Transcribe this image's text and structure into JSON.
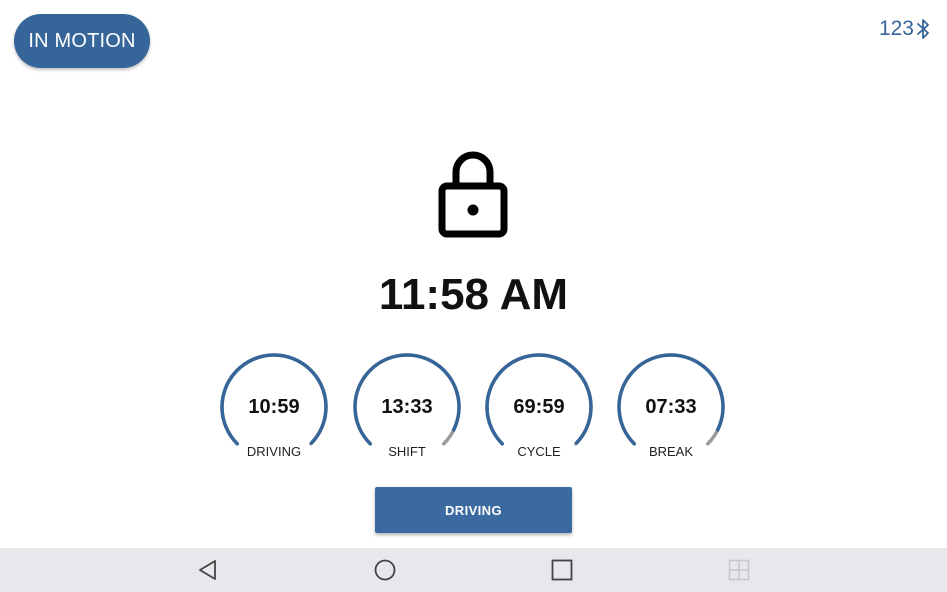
{
  "header": {
    "status_label": "IN MOTION",
    "device_id": "123",
    "bluetooth_icon": "bluetooth-icon"
  },
  "lock_icon": "lock-icon",
  "clock": {
    "time": "11:58 AM"
  },
  "gauges": [
    {
      "label": "DRIVING",
      "value": "10:59",
      "fill": 0.995
    },
    {
      "label": "SHIFT",
      "value": "13:33",
      "fill": 0.93
    },
    {
      "label": "CYCLE",
      "value": "69:59",
      "fill": 0.995
    },
    {
      "label": "BREAK",
      "value": "07:33",
      "fill": 0.93
    }
  ],
  "action_button": {
    "label": "DRIVING"
  },
  "navbar": {
    "icons": [
      "back-icon",
      "home-icon",
      "recents-icon",
      "grid-icon"
    ]
  },
  "colors": {
    "accent": "#36659a",
    "gauge_track": "#9a9a9a",
    "navbar_bg": "#e8e8ec"
  }
}
